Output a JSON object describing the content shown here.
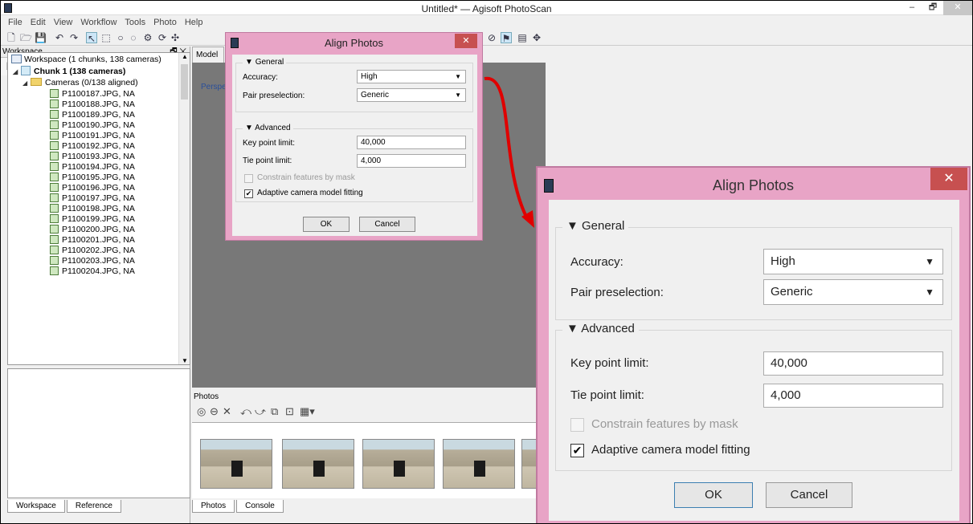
{
  "window": {
    "title": "Untitled* — Agisoft PhotoScan",
    "minimize": "–",
    "maximize": "🗗",
    "close": "✕"
  },
  "menu": [
    "File",
    "Edit",
    "View",
    "Workflow",
    "Tools",
    "Photo",
    "Help"
  ],
  "workspace": {
    "header": "Workspace",
    "header_ctrls": "🗗 ✕",
    "root": "Workspace (1 chunks, 138 cameras)",
    "chunk": "Chunk 1 (138 cameras)",
    "cameras_folder": "Cameras (0/138 aligned)",
    "cameras": [
      "P1100187.JPG, NA",
      "P1100188.JPG, NA",
      "P1100189.JPG, NA",
      "P1100190.JPG, NA",
      "P1100191.JPG, NA",
      "P1100192.JPG, NA",
      "P1100193.JPG, NA",
      "P1100194.JPG, NA",
      "P1100195.JPG, NA",
      "P1100196.JPG, NA",
      "P1100197.JPG, NA",
      "P1100198.JPG, NA",
      "P1100199.JPG, NA",
      "P1100200.JPG, NA",
      "P1100201.JPG, NA",
      "P1100202.JPG, NA",
      "P1100203.JPG, NA",
      "P1100204.JPG, NA"
    ],
    "tabs": [
      "Workspace",
      "Reference"
    ]
  },
  "model": {
    "tab": "Model",
    "perspective": "Perspe"
  },
  "photos": {
    "label": "Photos",
    "tabs": [
      "Photos",
      "Console"
    ]
  },
  "dialog": {
    "title": "Align Photos",
    "close": "✕",
    "general_label": "General",
    "accuracy_label": "Accuracy:",
    "accuracy_value": "High",
    "pair_label": "Pair preselection:",
    "pair_value": "Generic",
    "advanced_label": "Advanced",
    "key_point_label": "Key point limit:",
    "key_point_value": "40,000",
    "tie_point_label": "Tie point limit:",
    "tie_point_value": "4,000",
    "constrain_label": "Constrain features by mask",
    "constrain_checked": false,
    "adaptive_label": "Adaptive camera model fitting",
    "adaptive_checked": true,
    "check_mark": "✔",
    "ok": "OK",
    "cancel": "Cancel"
  },
  "colors": {
    "dialog_frame": "#e8a4c6",
    "close_button": "#c75050",
    "annotation_arrow": "#e00000",
    "viewport": "#787878"
  }
}
